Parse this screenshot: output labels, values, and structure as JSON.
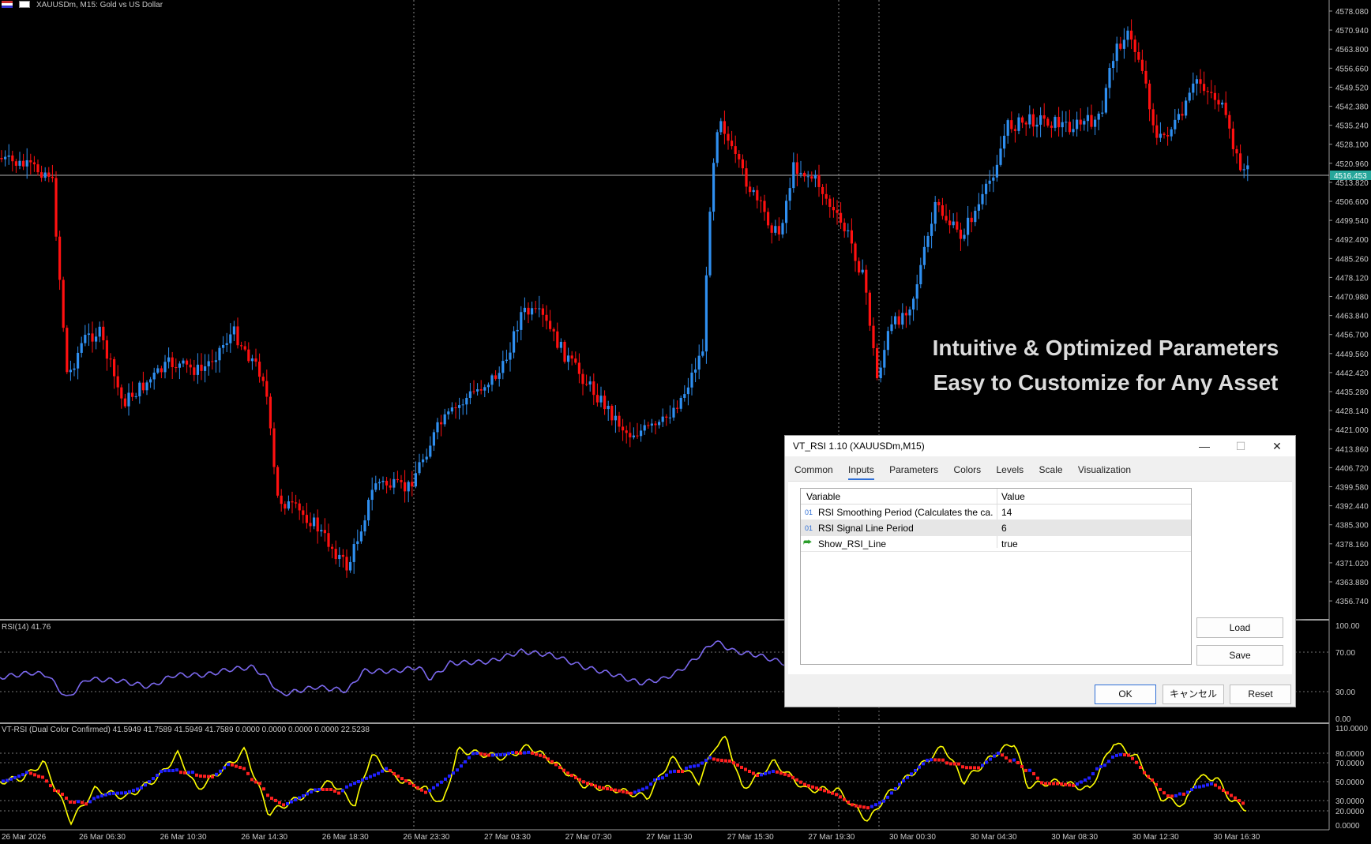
{
  "window": {
    "symbol_header": "XAUUSDm, M15:  Gold vs US Dollar"
  },
  "price_axis": {
    "labels": [
      "4578.080",
      "4570.940",
      "4563.800",
      "4556.660",
      "4549.520",
      "4542.380",
      "4535.240",
      "4528.100",
      "4520.960",
      "4513.820",
      "4506.600",
      "4499.540",
      "4492.400",
      "4485.260",
      "4478.120",
      "4470.980",
      "4463.840",
      "4456.700",
      "4449.560",
      "4442.420",
      "4435.280",
      "4428.140",
      "4421.000",
      "4413.860",
      "4406.720",
      "4399.580",
      "4392.440",
      "4385.300",
      "4378.160",
      "4371.020",
      "4363.880",
      "4356.740"
    ],
    "current_price": "4516.453"
  },
  "rsi_panel": {
    "label": "RSI(14) 41.76",
    "levels": [
      "100.00",
      "70.00",
      "30.00",
      "0.00"
    ]
  },
  "vt_rsi_panel": {
    "label": "VT-RSI (Dual Color Confirmed) 41.5949 41.7589 41.5949 41.7589 0.0000 0.0000 0.0000 0.0000 22.5238",
    "levels": [
      "110.0000",
      "80.0000",
      "70.0000",
      "50.0000",
      "30.0000",
      "20.0000",
      "0.0000"
    ]
  },
  "time_axis": {
    "labels": [
      "26 Mar 2026",
      "26 Mar 06:30",
      "26 Mar 10:30",
      "26 Mar 14:30",
      "26 Mar 18:30",
      "26 Mar 23:30",
      "27 Mar 03:30",
      "27 Mar 07:30",
      "27 Mar 11:30",
      "27 Mar 15:30",
      "27 Mar 19:30",
      "30 Mar 00:30",
      "30 Mar 04:30",
      "30 Mar 08:30",
      "30 Mar 12:30",
      "30 Mar 16:30"
    ]
  },
  "promo": {
    "line1": "Intuitive & Optimized Parameters",
    "line2": "Easy to Customize for Any Asset"
  },
  "dialog": {
    "title": "VT_RSI 1.10 (XAUUSDm,M15)",
    "minimize": "—",
    "maximize": "☐",
    "close": "✕",
    "tabs": [
      "Common",
      "Inputs",
      "Parameters",
      "Colors",
      "Levels",
      "Scale",
      "Visualization"
    ],
    "active_tab": "Inputs",
    "grid": {
      "col_variable": "Variable",
      "col_value": "Value",
      "rows": [
        {
          "prefix": "01",
          "name": "RSI Smoothing Period (Calculates the ca...",
          "value": "14"
        },
        {
          "prefix": "01",
          "name": "RSI Signal Line Period",
          "value": "6"
        },
        {
          "prefix": "",
          "name": "Show_RSI_Line",
          "value": "true"
        }
      ]
    },
    "load_label": "Load",
    "save_label": "Save",
    "ok_label": "OK",
    "cancel_label": "キャンセル",
    "reset_label": "Reset"
  },
  "colors": {
    "bull": "#2f8ff0",
    "bear": "#ff1010",
    "rsi_line": "#7b68ee",
    "vt_line": "#ffff00",
    "vt_up": "#2020ff",
    "vt_down": "#ff2020",
    "price_tag": "#26a69a"
  }
}
